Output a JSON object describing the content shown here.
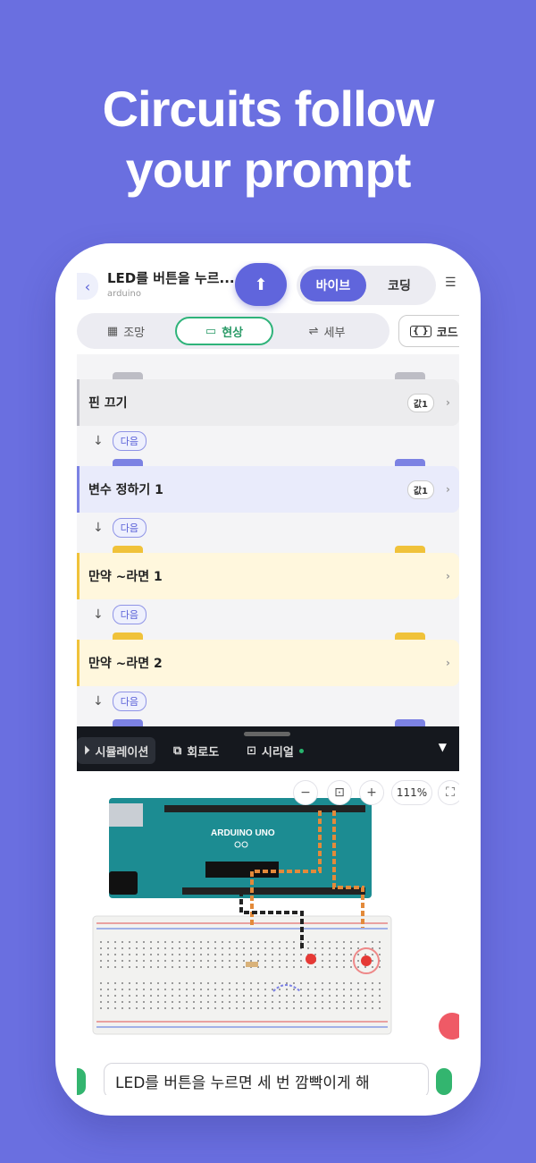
{
  "hero": {
    "line1": "Circuits follow",
    "line2": "your prompt"
  },
  "app": {
    "title": "LED를 버튼을 누르...",
    "subtitle": "arduino",
    "mode_tabs": [
      "바이브",
      "코딩"
    ],
    "view_tabs": [
      "조망",
      "현상",
      "세부"
    ],
    "code_label": "코드"
  },
  "blocks": [
    {
      "label": "핀 끄기",
      "badge": "값1",
      "color": "#ececee",
      "border": "#bdbdc5"
    },
    {
      "label": "변수 정하기 1",
      "badge": "값1",
      "color": "#e9ebfb",
      "border": "#7c82e3"
    },
    {
      "label": "만약 ~라면 1",
      "badge": "",
      "color": "#fff7dd",
      "border": "#f0c23a"
    },
    {
      "label": "만약 ~라면 2",
      "badge": "",
      "color": "#fff7dd",
      "border": "#f0c23a"
    }
  ],
  "next_label": "다음",
  "sim_tabs": [
    "시뮬레이션",
    "회로도",
    "시리얼"
  ],
  "zoom": "111%",
  "board_label": "ARDUINO UNO",
  "prompt_text": "LED를 버튼을 누르면 세 번 깜빡이게 해",
  "colors": {
    "accent": "#6065dc",
    "background": "#6a6fe0",
    "green": "#2fb37a"
  }
}
